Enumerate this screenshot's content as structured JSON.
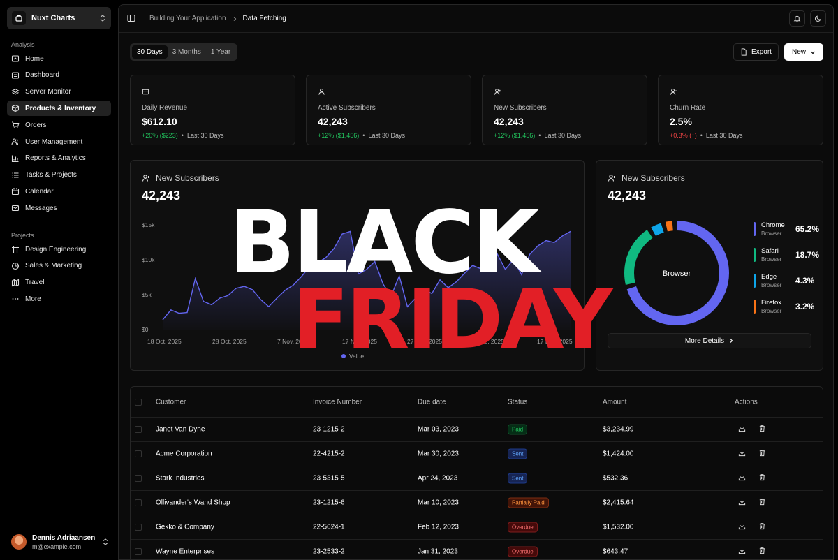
{
  "app": {
    "name": "Nuxt Charts"
  },
  "sidebar": {
    "section_analysis": "Analysis",
    "analysis_items": [
      {
        "label": "Home",
        "icon": "home-icon"
      },
      {
        "label": "Dashboard",
        "icon": "dashboard-icon"
      },
      {
        "label": "Server Monitor",
        "icon": "layers-icon"
      },
      {
        "label": "Products & Inventory",
        "icon": "box-icon",
        "active": true
      },
      {
        "label": "Orders",
        "icon": "cart-icon"
      },
      {
        "label": "User Management",
        "icon": "users-icon"
      },
      {
        "label": "Reports & Analytics",
        "icon": "bar-chart-icon"
      },
      {
        "label": "Tasks & Projects",
        "icon": "list-icon"
      },
      {
        "label": "Calendar",
        "icon": "calendar-icon"
      },
      {
        "label": "Messages",
        "icon": "mail-icon"
      }
    ],
    "section_projects": "Projects",
    "project_items": [
      {
        "label": "Design Engineering",
        "icon": "frame-icon"
      },
      {
        "label": "Sales & Marketing",
        "icon": "pie-chart-icon"
      },
      {
        "label": "Travel",
        "icon": "map-icon"
      },
      {
        "label": "More",
        "icon": "more-icon"
      }
    ],
    "user": {
      "name": "Dennis Adriaansen",
      "email": "m@example.com"
    }
  },
  "header": {
    "breadcrumb": [
      "Building Your Application",
      "Data Fetching"
    ]
  },
  "toolbar": {
    "ranges": [
      "30 Days",
      "3 Months",
      "1 Year"
    ],
    "active_range": "30 Days",
    "export_label": "Export",
    "new_label": "New"
  },
  "stats": [
    {
      "label": "Daily Revenue",
      "value": "$612.10",
      "change": "+20% ($223)",
      "trend": "up",
      "period": "Last 30 Days",
      "icon": "card-icon"
    },
    {
      "label": "Active Subscribers",
      "value": "42,243",
      "change": "+12% ($1,456)",
      "trend": "up",
      "period": "Last 30 Days",
      "icon": "user-icon"
    },
    {
      "label": "New Subscribers",
      "value": "42,243",
      "change": "+12% ($1,456)",
      "trend": "up",
      "period": "Last 30 Days",
      "icon": "user-plus-icon"
    },
    {
      "label": "Churn Rate",
      "value": "2.5%",
      "change": "+0.3% (↑)",
      "trend": "down",
      "period": "Last 30 Days",
      "icon": "user-minus-icon"
    }
  ],
  "line_card": {
    "title": "New Subscribers",
    "value": "42,243"
  },
  "donut_card": {
    "title": "New Subscribers",
    "value": "42,243",
    "center_label": "Browser",
    "more_label": "More Details"
  },
  "chart_data": [
    {
      "type": "area",
      "x_ticks": [
        "18 Oct, 2025",
        "28 Oct, 2025",
        "7 Nov, 2025",
        "17 Nov, 2025",
        "27 Nov, 2025",
        "7 Dec, 2025",
        "17 Dec, 2025"
      ],
      "y_ticks": [
        "$0",
        "$5k",
        "$10k",
        "$15k"
      ],
      "ylim": [
        0,
        16000
      ],
      "series": [
        {
          "name": "Value",
          "color": "#6366f1",
          "values": [
            1500,
            3000,
            2500,
            2600,
            7800,
            4300,
            3800,
            4800,
            5200,
            6300,
            6600,
            6100,
            4600,
            3500,
            4800,
            6000,
            6800,
            8100,
            9600,
            10200,
            11000,
            12400,
            14600,
            15000,
            8500,
            9200,
            10400,
            7000,
            5100,
            8200,
            3500,
            4800,
            6200,
            5500,
            7600,
            6400,
            7300,
            8600,
            9800,
            9300,
            10200,
            11600,
            9200,
            10700,
            8400,
            11500,
            12800,
            13600,
            13300,
            14300,
            15000
          ]
        }
      ]
    },
    {
      "type": "pie",
      "variant": "donut",
      "series": [
        {
          "name": "Chrome",
          "sub": "Browser",
          "value": 65.2,
          "label": "65.2%",
          "color": "#6366f1"
        },
        {
          "name": "Safari",
          "sub": "Browser",
          "value": 18.7,
          "label": "18.7%",
          "color": "#10b981"
        },
        {
          "name": "Edge",
          "sub": "Browser",
          "value": 4.3,
          "label": "4.3%",
          "color": "#0ea5e9"
        },
        {
          "name": "Firefox",
          "sub": "Browser",
          "value": 3.2,
          "label": "3.2%",
          "color": "#f97316"
        }
      ]
    }
  ],
  "table": {
    "columns": [
      "Customer",
      "Invoice Number",
      "Due date",
      "Status",
      "Amount",
      "Actions"
    ],
    "rows": [
      {
        "customer": "Janet Van Dyne",
        "invoice": "23-1215-2",
        "due": "Mar 03, 2023",
        "status": "Paid",
        "status_kind": "paid",
        "amount": "$3,234.99"
      },
      {
        "customer": "Acme Corporation",
        "invoice": "22-4215-2",
        "due": "Mar 30, 2023",
        "status": "Sent",
        "status_kind": "sent",
        "amount": "$1,424.00"
      },
      {
        "customer": "Stark Industries",
        "invoice": "23-5315-5",
        "due": "Apr 24, 2023",
        "status": "Sent",
        "status_kind": "sent",
        "amount": "$532.36"
      },
      {
        "customer": "Ollivander's Wand Shop",
        "invoice": "23-1215-6",
        "due": "Mar 10, 2023",
        "status": "Partially Paid",
        "status_kind": "partial",
        "amount": "$2,415.64"
      },
      {
        "customer": "Gekko & Company",
        "invoice": "22-5624-1",
        "due": "Feb 12, 2023",
        "status": "Overdue",
        "status_kind": "overdue",
        "amount": "$1,532.00"
      },
      {
        "customer": "Wayne Enterprises",
        "invoice": "23-2533-2",
        "due": "Jan 31, 2023",
        "status": "Overdue",
        "status_kind": "overdue",
        "amount": "$643.47"
      }
    ]
  },
  "overlay": {
    "line1": "BLACK",
    "line2": "FRIDAY",
    "color1": "#ffffff",
    "color2": "#e21f26"
  }
}
